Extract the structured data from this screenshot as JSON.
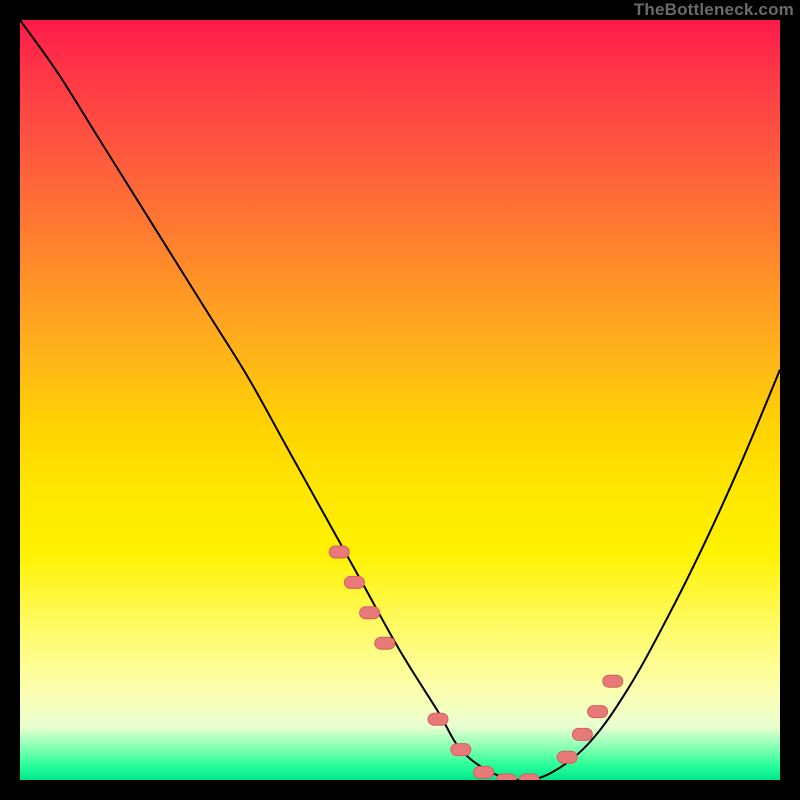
{
  "watermark": "TheBottleneck.com",
  "colors": {
    "curve_stroke": "#000000",
    "marker_fill": "#e77a78",
    "marker_stroke": "#d65f5d",
    "frame": "#000000"
  },
  "chart_data": {
    "type": "line",
    "title": "",
    "xlabel": "",
    "ylabel": "",
    "xlim": [
      0,
      100
    ],
    "ylim": [
      0,
      100
    ],
    "grid": false,
    "legend": false,
    "series": [
      {
        "name": "bottleneck-curve",
        "x": [
          0,
          5,
          10,
          15,
          20,
          25,
          30,
          35,
          40,
          45,
          50,
          55,
          58,
          62,
          66,
          70,
          75,
          80,
          85,
          90,
          95,
          100
        ],
        "y": [
          100,
          93,
          85,
          77,
          69,
          61,
          53,
          44,
          35,
          26,
          17,
          9,
          4,
          1,
          0,
          1,
          5,
          12,
          21,
          31,
          42,
          54
        ]
      }
    ],
    "markers": {
      "name": "highlight-points",
      "x": [
        42,
        44,
        46,
        48,
        55,
        58,
        61,
        64,
        67,
        72,
        74,
        76,
        78
      ],
      "y": [
        30,
        26,
        22,
        18,
        8,
        4,
        1,
        0,
        0,
        3,
        6,
        9,
        13
      ]
    },
    "background_gradient_stops": [
      {
        "pos": 0.0,
        "color": "#ff1a4a"
      },
      {
        "pos": 0.18,
        "color": "#ff5a3e"
      },
      {
        "pos": 0.44,
        "color": "#ffb41a"
      },
      {
        "pos": 0.7,
        "color": "#fff200"
      },
      {
        "pos": 0.93,
        "color": "#e8ffd0"
      },
      {
        "pos": 1.0,
        "color": "#00e68c"
      }
    ]
  }
}
